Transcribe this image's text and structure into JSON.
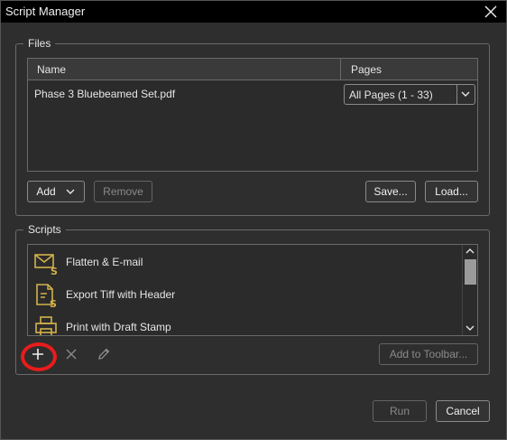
{
  "window": {
    "title": "Script Manager",
    "close_icon": "close-icon"
  },
  "files": {
    "legend": "Files",
    "columns": {
      "name": "Name",
      "pages": "Pages"
    },
    "rows": [
      {
        "name": "Phase 3 Bluebeamed Set.pdf",
        "pages": "All Pages (1 - 33)"
      }
    ],
    "buttons": {
      "add": "Add",
      "remove": "Remove",
      "save": "Save...",
      "load": "Load..."
    }
  },
  "scripts": {
    "legend": "Scripts",
    "items": [
      {
        "label": "Flatten & E-mail",
        "icon": "email-script-icon"
      },
      {
        "label": "Export Tiff with Header",
        "icon": "document-script-icon"
      },
      {
        "label": "Print with Draft Stamp",
        "icon": "printer-script-icon"
      }
    ],
    "add_to_toolbar": "Add to Toolbar..."
  },
  "footer": {
    "run": "Run",
    "cancel": "Cancel"
  },
  "colors": {
    "accent_icon": "#d4b24a",
    "highlight": "#e81c1c"
  }
}
